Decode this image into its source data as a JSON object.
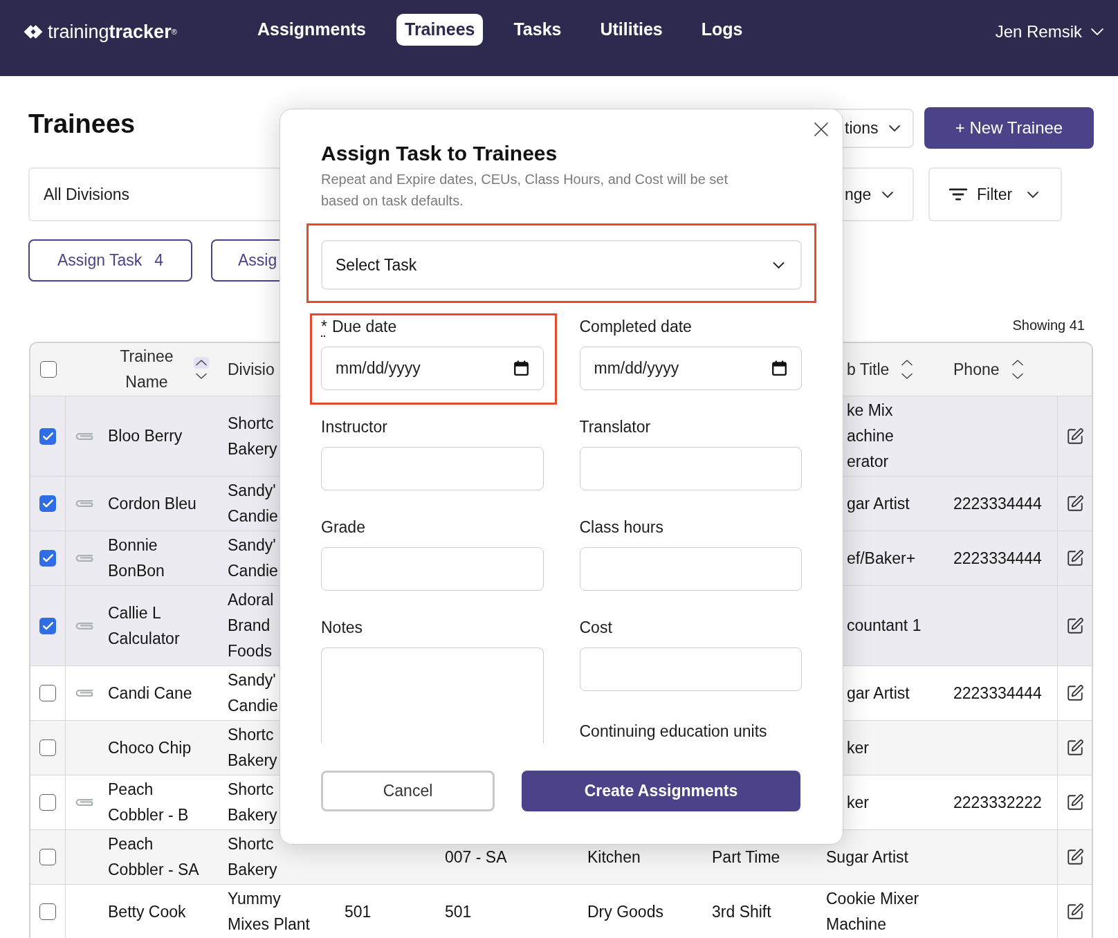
{
  "nav": {
    "logo": "training**tracker**$^{®}$",
    "items": [
      {
        "label": "Assignments",
        "selected": false
      },
      {
        "label": "Trainees",
        "selected": true
      },
      {
        "label": "Tasks",
        "selected": false
      },
      {
        "label": "Utilities",
        "selected": false
      },
      {
        "label": "Logs",
        "selected": false
      }
    ],
    "user": "Jen Remsik"
  },
  "page": {
    "title": "Trainees",
    "actions_dropdown": "tions",
    "new_button": "+ New Trainee",
    "division_select": "All Divisions",
    "range_select": "nge",
    "filter_button": "Filter",
    "assign_button": {
      "label": "Assign Task",
      "count": "4"
    },
    "second_button": "Assig",
    "showing": "Showing 41"
  },
  "table": {
    "select_all": {
      "checked": false
    },
    "columns": [
      {
        "label": "Trainee Name",
        "sorted": true
      },
      {
        "label": "Divisio"
      },
      {
        "label": "b Title",
        "sorted": false
      },
      {
        "label": "Phone",
        "sorted": false
      }
    ],
    "rows": [
      {
        "checked": true,
        "attachment": true,
        "name": "Bloo Berry",
        "division": [
          "Shortc",
          "Bakery"
        ],
        "title": [
          "ke Mix",
          "achine",
          "erator"
        ]
      },
      {
        "checked": true,
        "attachment": true,
        "name": "Cordon Bleu",
        "division": [
          "Sandy'",
          "Candie"
        ],
        "title": [
          "gar Artist"
        ],
        "phone": "2223334444"
      },
      {
        "checked": true,
        "attachment": true,
        "name": "Bonnie BonBon",
        "division": [
          "Sandy'",
          "Candie"
        ],
        "title": [
          "ef/Baker+"
        ],
        "phone": "2223334444"
      },
      {
        "checked": true,
        "attachment": true,
        "name": "Callie L Calculator",
        "division": [
          "Adoral",
          "Brand",
          "Foods"
        ],
        "title": [
          "countant 1"
        ]
      },
      {
        "checked": false,
        "attachment": true,
        "name": "Candi Cane",
        "division": [
          "Sandy'",
          "Candie"
        ],
        "title": [
          "gar Artist"
        ],
        "phone": "2223334444"
      },
      {
        "checked": false,
        "attachment": false,
        "name": "Choco Chip",
        "division": [
          "Shortc",
          "Bakery"
        ],
        "title": [
          "ker"
        ]
      },
      {
        "checked": false,
        "attachment": true,
        "name": "Peach Cobbler - B",
        "division": [
          "Shortc",
          "Bakery"
        ],
        "title": [
          "ker"
        ],
        "phone": "2223332222"
      },
      {
        "checked": false,
        "attachment": false,
        "name": "Peach Cobbler - SA",
        "division": [
          "Shortc",
          "Bakery"
        ],
        "column_4": "007 - SA",
        "column_5": "Kitchen",
        "column_6": "Part Time",
        "title": [
          "Sugar Artist"
        ]
      },
      {
        "checked": false,
        "attachment": false,
        "name": "Betty Cook",
        "division": [
          "Yummy",
          "Mixes Plant"
        ],
        "column_3": "501",
        "column_4": "501",
        "column_5": "Dry Goods",
        "column_6": "3rd Shift",
        "title": [
          "Cookie Mixer",
          "Machine"
        ]
      }
    ]
  },
  "modal": {
    "title": "Assign Task to Trainees",
    "subtitle": "Repeat and Expire dates, CEUs, Class Hours, and Cost will be set based on task defaults.",
    "fields": [
      {
        "kind": "select",
        "placeholder": "Select Task",
        "highlighted": true
      },
      {
        "kind": "date",
        "label": "Due date",
        "required_mark": "*",
        "placeholder": "mm/dd/yyyy",
        "highlighted": true
      },
      {
        "kind": "date",
        "label": "Completed date",
        "placeholder": "mm/dd/yyyy",
        "highlighted": false
      },
      {
        "kind": "text",
        "label": "Instructor",
        "highlighted": false
      },
      {
        "kind": "text",
        "label": "Translator",
        "highlighted": false
      },
      {
        "kind": "text",
        "label": "Grade",
        "highlighted": false
      },
      {
        "kind": "text",
        "label": "Class hours",
        "highlighted": false
      },
      {
        "kind": "textarea",
        "label": "Notes",
        "highlighted": false
      },
      {
        "kind": "text",
        "label": "Cost",
        "highlighted": false
      },
      {
        "kind": "label",
        "label": "Continuing education units",
        "highlighted": false
      }
    ],
    "buttons": [
      {
        "label": "Cancel",
        "kind": "secondary"
      },
      {
        "label": "Create Assignments",
        "kind": "primary"
      }
    ]
  }
}
